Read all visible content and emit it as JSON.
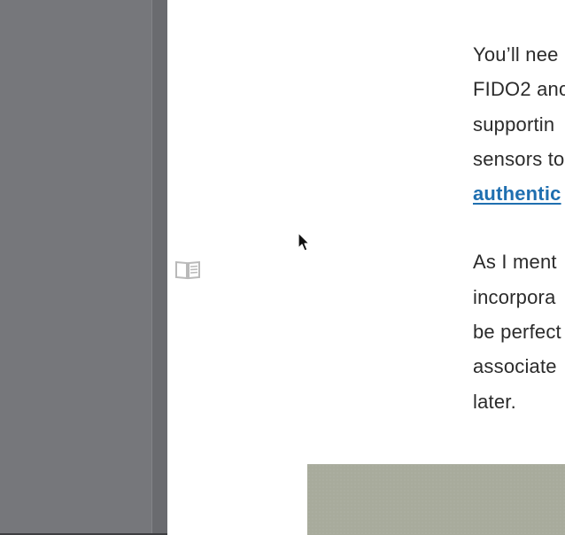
{
  "sidebar": {},
  "reader": {
    "icon": "reader-mode-book-icon"
  },
  "article": {
    "paragraphs": [
      {
        "lines": [
          "You’ll nee",
          "FIDO2 anc",
          "supportin",
          "sensors to"
        ],
        "link": "authentic"
      },
      {
        "lines": [
          "As I ment",
          "incorpora",
          "be perfect",
          "associate",
          "later."
        ]
      }
    ]
  },
  "colors": {
    "sidebar_bg": "#76777b",
    "page_bg": "#ffffff",
    "text": "#2b2b2b",
    "link": "#1f6fb0",
    "image_bg": "#a8ab9c"
  }
}
